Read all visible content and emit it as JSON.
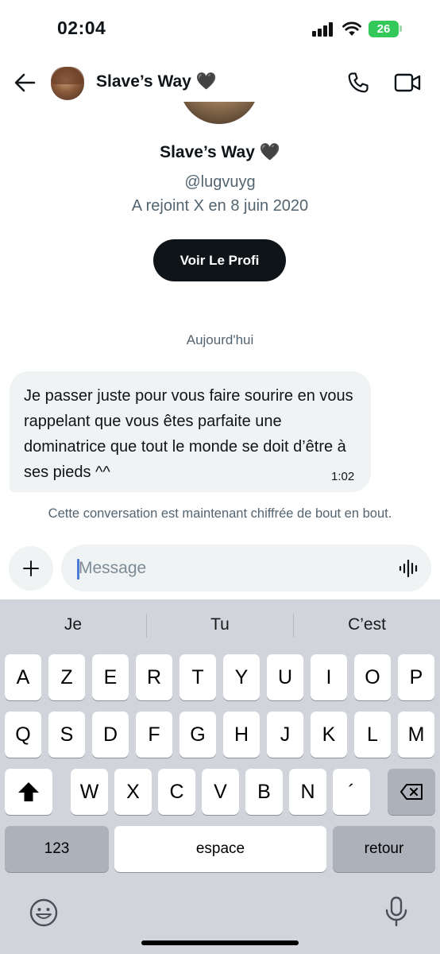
{
  "status": {
    "time": "02:04",
    "battery": "26"
  },
  "header": {
    "name": "Slave’s Way",
    "emoji": "🖤"
  },
  "profile": {
    "name": "Slave’s Way",
    "emoji": "🖤",
    "handle": "@lugvuyg",
    "joined": "A rejoint X en 8 juin 2020",
    "button_label": "Voir Le Profi"
  },
  "conversation": {
    "day": "Aujourd'hui",
    "messages": [
      {
        "text": "Je passer juste pour vous faire sourire en vous rappelant que vous êtes parfaite une dominatrice que tout le monde se doit d’être à ses pieds ^^",
        "time": "1:02"
      }
    ],
    "encryption_note": "Cette conversation est maintenant chiffrée de bout en bout."
  },
  "composer": {
    "placeholder": "Message"
  },
  "keyboard": {
    "suggestions": [
      "Je",
      "Tu",
      "C’est"
    ],
    "row1": [
      "A",
      "Z",
      "E",
      "R",
      "T",
      "Y",
      "U",
      "I",
      "O",
      "P"
    ],
    "row2": [
      "Q",
      "S",
      "D",
      "F",
      "G",
      "H",
      "J",
      "K",
      "L",
      "M"
    ],
    "row3": [
      "W",
      "X",
      "C",
      "V",
      "B",
      "N",
      "´"
    ],
    "numbers_key": "123",
    "space_key": "espace",
    "return_key": "retour"
  },
  "colors": {
    "accent": "#0f1419",
    "secondary_text": "#536471",
    "bubble": "#eff3f4",
    "battery": "#34c759"
  }
}
